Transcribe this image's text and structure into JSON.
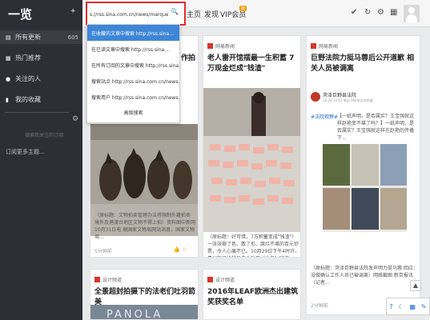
{
  "sidebar": {
    "logo": "一览",
    "items": [
      {
        "label": "所有更新",
        "count": "605"
      },
      {
        "label": "热门推荐",
        "count": ""
      },
      {
        "label": "关注的人",
        "count": ""
      },
      {
        "label": "我的收藏",
        "count": ""
      }
    ],
    "hint": "搜索我关注的订阅",
    "subscribe": "订阅更多主题..."
  },
  "topbar": {
    "links": [
      "主页",
      "发现"
    ],
    "vip": "VIP会员",
    "vip_badge": "新"
  },
  "search": {
    "value": "s://rss.sina.com.cn/news/marquee/ddt.xml",
    "dropdown": [
      "在收藏的文章中搜索 http://rss.sina...",
      "在已读文章中搜索 http://rss.sina...",
      "在所有订阅的文章中搜索 http://rss.sina...",
      "搜索站点 http://rss.sina.com.cn/news...",
      "搜索用户 http://rss.sina.com.cn/news..."
    ],
    "advanced": "高级搜索"
  },
  "cards": [
    {
      "source": "",
      "title": "作拍",
      "desc": "（原标题：文物拍卖管理办法将限制外籍拍卖 境外及港澳台地区文物不得上拍）资料图中新网10月31日电 据国家文物局网站消息，国家文物局...",
      "time": "5分钟前"
    },
    {
      "source": "网易新闻",
      "title": "老人雷开馆摆最一生积蓄 7万现金烂成\"钱渣\"",
      "desc": "（原标题：好可惜，7万积蓄变成\"钱渣\"）一张张褪了色、散了形、腐烂不堪的百元钞票，令人心痛不已。10月29日下午4时许，贵州铜仁松桃县老人孙平（化名）家中..."
    },
    {
      "source": "网易新闻",
      "title": "巨野法院力挺马蓉后公开道歉 相关人员被调离",
      "account": "菏泽巨野县法院",
      "account_time": "10-28 14:12  来自 360安全浏览器",
      "tag": "#法院观察#",
      "post": "【一纸声明，是否属实？王宝强就这样赵艳变不堪了吗？】一纸声明，是否属实？王宝强就这样在赵艳的传播下...",
      "desc": "（原标题：菏泽巨野县法院发声明力挺马蓉 回应：没做确认工作人员已被调离）网络截图 新京报讯（记者...",
      "time": "2分钟前"
    },
    {
      "source": "设计频道",
      "title": "全景超封拍摄下的法老们吐羽箭美"
    },
    {
      "source": "设计频道",
      "title": "2016年LEAF欧洲杰出建筑奖获奖名单"
    }
  ],
  "colors": {
    "sidebar_bg": "#2c3036",
    "accent_red": "#e52b2b",
    "dropdown_hover": "#3d86d8"
  }
}
